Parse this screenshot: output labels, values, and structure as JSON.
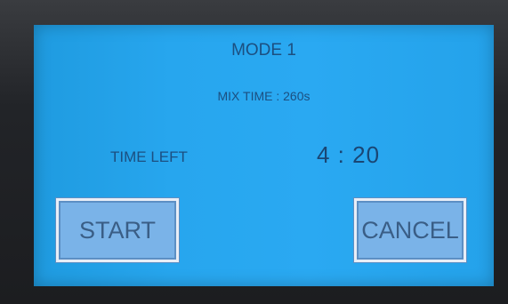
{
  "screen": {
    "title": "MODE 1",
    "mix_time": "MIX TIME : 260s",
    "time_left_label": "TIME LEFT",
    "countdown": "4 : 20"
  },
  "buttons": {
    "start_label": "START",
    "cancel_label": "CANCEL"
  },
  "colors": {
    "screen_background": "#27a6ee",
    "text": "#1c4f80",
    "button_fill": "#7ab3e8",
    "button_border": "#e8eef7"
  }
}
